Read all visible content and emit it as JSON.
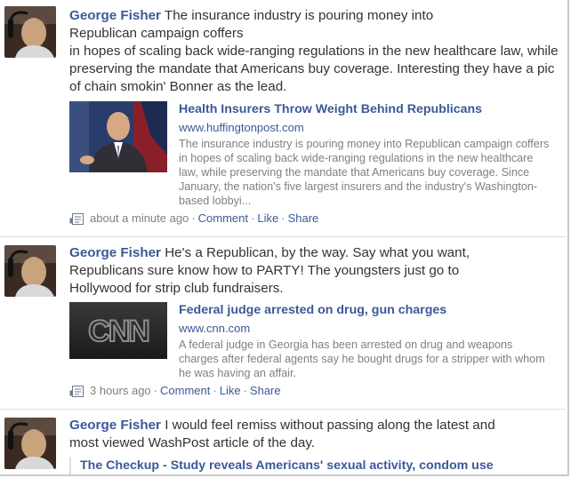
{
  "posts": [
    {
      "author": "George Fisher",
      "message": " The insurance industry is pouring money into Republican campaign coffers",
      "message2": "in hopes of scaling back wide-ranging regulations in the new healthcare law, while preserving the mandate that Americans buy coverage. Interesting they have a pic of chain smokin' Bonner as the lead.",
      "attachment": {
        "title": "Health Insurers Throw Weight Behind Republicans",
        "domain": "www.huffingtonpost.com",
        "description": "The insurance industry is pouring money into Republican campaign coffers in hopes of scaling back wide-ranging regulations in the new healthcare law, while preserving the mandate that Americans buy coverage. Since January, the nation's five largest insurers and the industry's Washington-based lobbyi..."
      },
      "time": "about a minute ago",
      "comment_label": "Comment",
      "like_label": "Like",
      "share_label": "Share"
    },
    {
      "author": "George Fisher",
      "message": " He's a Republican, by the way. Say what you want, Republicans sure know how to PARTY! The youngsters just go to Hollywood for strip club fundraisers.",
      "attachment": {
        "title": "Federal judge arrested on drug, gun charges",
        "domain": "www.cnn.com",
        "description": "A federal judge in Georgia has been arrested on drug and weapons charges after federal agents say he bought drugs for a stripper with whom he was having an affair.",
        "logo_text": "CNN"
      },
      "time": "3 hours ago",
      "comment_label": "Comment",
      "like_label": "Like",
      "share_label": "Share"
    },
    {
      "author": "George Fisher",
      "message": " I would feel remiss without passing along the latest and most viewed WashPost article of the day.",
      "attachment": {
        "title": "The Checkup - Study reveals Americans' sexual activity, condom use"
      }
    }
  ],
  "colors": {
    "link": "#3b5998",
    "muted": "#808080",
    "text": "#333333"
  },
  "icons": {
    "meta": "note-icon"
  }
}
